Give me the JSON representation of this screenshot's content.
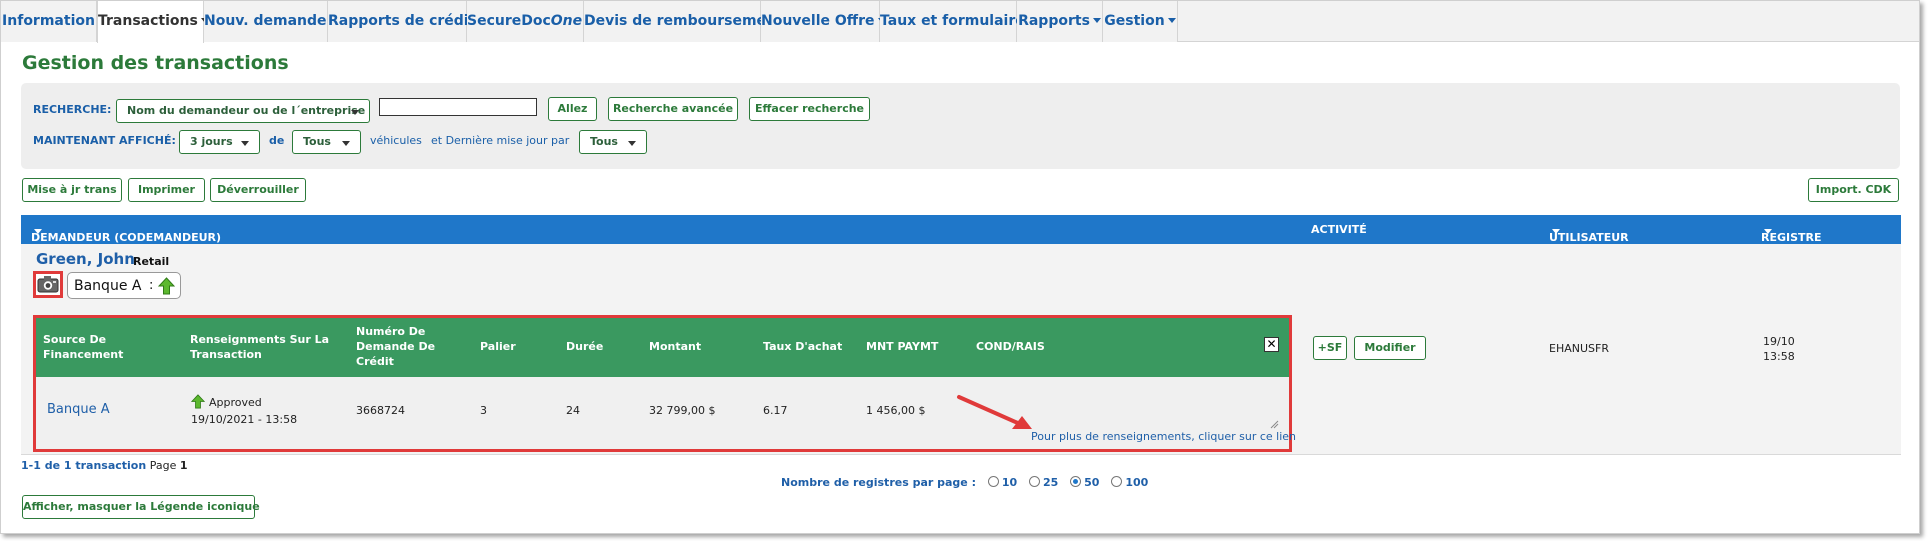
{
  "nav": {
    "tabs": [
      {
        "label": "Information",
        "dropdown": false
      },
      {
        "label": "Transactions",
        "dropdown": true,
        "active": true
      },
      {
        "label": "Nouv. demande",
        "dropdown": true
      },
      {
        "label": "Rapports de crédit",
        "dropdown": true
      },
      {
        "label_main": "SecureDoc",
        "label_italic": "One",
        "dropdown": true
      },
      {
        "label": "Devis de remboursement",
        "dropdown": true
      },
      {
        "label": "Nouvelle Offre",
        "dropdown": true
      },
      {
        "label": "Taux et formulaires",
        "dropdown": false
      },
      {
        "label": "Rapports",
        "dropdown": true
      },
      {
        "label": "Gestion",
        "dropdown": true
      }
    ]
  },
  "page": {
    "title": "Gestion des transactions"
  },
  "search": {
    "label": "RECHERCHE:",
    "field_select": "Nom du demandeur ou de l´entreprise",
    "input_value": "",
    "go_button": "Allez",
    "advanced_button": "Recherche avancée",
    "clear_button": "Effacer recherche",
    "showing_label": "MAINTENANT AFFICHÉ:",
    "days_select": "3 jours",
    "of_label": "de",
    "vehicles_select": "Tous",
    "vehicles_label": "véhicules",
    "updated_by_label": "et Dernière mise jour par",
    "updated_by_select": "Tous"
  },
  "actions": {
    "update": "Mise à jr trans",
    "print": "Imprimer",
    "unlock": "Déverrouiller",
    "import": "Import. CDK"
  },
  "table": {
    "col_applicant": "DEMANDEUR (CODEMANDEUR)",
    "col_activity": "ACTIVITÉ",
    "col_user": "UTILISATEUR",
    "col_register": "REGISTRE"
  },
  "row": {
    "name": "Green, John",
    "type": "Retail",
    "bank_chip": "Banque A",
    "bank_chip_sep": ":",
    "fin_headers": {
      "source": [
        "Source De",
        "Financement"
      ],
      "info": [
        "Renseignments Sur La",
        "Transaction"
      ],
      "number": [
        "Numéro De",
        "Demande De",
        "Crédit"
      ],
      "tier": "Palier",
      "term": "Durée",
      "amount": "Montant",
      "rate": "Taux D'achat",
      "payment": "MNT PAYMT",
      "cond": "COND/RAIS"
    },
    "fin_values": {
      "source": "Banque A",
      "status": "Approved",
      "datetime": "19/10/2021 - 13:58",
      "number": "3668724",
      "tier": "3",
      "term": "24",
      "amount": "32 799,00 $",
      "rate": "6.17",
      "payment": "1 456,00 $",
      "link": "Pour plus de renseignements, cliquer sur ce lien"
    },
    "sf_button": "+SF",
    "modify_button": "Modifier",
    "user": "EHANUSFR",
    "register_date": "19/10",
    "register_time": "13:58"
  },
  "footer": {
    "count": "1-1 de 1 transaction",
    "page_label": "Page",
    "page_num": "1",
    "per_page_label": "Nombre de registres par page :",
    "per_page_options": [
      "10",
      "25",
      "50",
      "100"
    ],
    "per_page_selected": "50",
    "legend_button": "Afficher, masquer la Légende iconique"
  },
  "colors": {
    "green": "#2c7a3a",
    "blue": "#1f77c9",
    "fin_green": "#3a9960",
    "highlight": "#e03a3a"
  }
}
